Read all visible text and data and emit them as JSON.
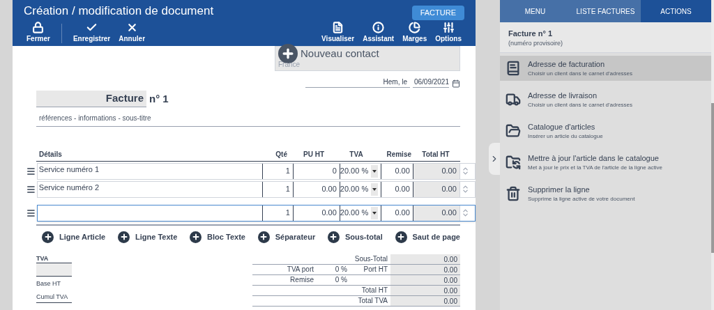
{
  "header": {
    "title": "Création / modification de document",
    "doc_type": "FACTURE",
    "left_tools": [
      {
        "kind": "lock",
        "label": "Fermer"
      },
      {
        "kind": "check",
        "label": "Enregistrer"
      },
      {
        "kind": "cancel",
        "label": "Annuler"
      }
    ],
    "right_tools": [
      {
        "kind": "pdf",
        "label": "Visualiser"
      },
      {
        "kind": "info",
        "label": "Assistant"
      },
      {
        "kind": "pie",
        "label": "Marges"
      },
      {
        "kind": "options",
        "label": "Options"
      }
    ]
  },
  "contact": {
    "button": "Nouveau contact",
    "country": "France"
  },
  "place": "Hem, le",
  "date": "06/09/2021",
  "doc_title": {
    "type": "Facture",
    "number": "n° 1"
  },
  "subtitle": "références - informations - sous-titre",
  "columns": [
    "Détails",
    "Qté",
    "PU HT",
    "TVA",
    "Remise",
    "Total HT"
  ],
  "lines": [
    {
      "details": "Service numéro 1",
      "qty": "1",
      "pu_ht": "0",
      "tva": "20.00 %",
      "remise": "0.00",
      "total_ht": "0.00",
      "active": false
    },
    {
      "details": "Service numéro 2",
      "qty": "1",
      "pu_ht": "0.00",
      "tva": "20.00 %",
      "remise": "0.00",
      "total_ht": "0.00",
      "active": false
    },
    {
      "qty": "1",
      "pu_ht": "0.00",
      "tva": "20.00 %",
      "remise": "0.00",
      "total_ht": "0.00",
      "active": true
    }
  ],
  "add_buttons": [
    "Ligne Article",
    "Ligne Texte",
    "Bloc Texte",
    "Séparateur",
    "Sous-total",
    "Saut de page"
  ],
  "vat_table": {
    "heading": "TVA",
    "rows": [
      "Base HT",
      "Cumul TVA"
    ]
  },
  "totals": [
    {
      "label": "Sous-Total",
      "value": "0.00"
    },
    {
      "extra_label": "TVA port",
      "extra_value": "0 %",
      "label": "Port HT",
      "value": "0.00"
    },
    {
      "extra_label": "Remise",
      "extra_value": "0 %",
      "value": "0.00"
    },
    {
      "label": "Total HT",
      "value": "0.00"
    },
    {
      "label": "Total TVA",
      "value": "0.00"
    }
  ],
  "sidebar": {
    "tabs": [
      {
        "label": "MENU",
        "selected": false
      },
      {
        "label": "LISTE FACTURES",
        "selected": false
      },
      {
        "label": "ACTIONS",
        "selected": true
      }
    ],
    "doc_title": "Facture n° 1",
    "doc_note": "(numéro provisoire)",
    "actions": [
      {
        "kind": "book",
        "title": "Adresse de facturation",
        "description": "Choisir un client dans le carnet d'adresses",
        "selected": true
      },
      {
        "kind": "truck",
        "title": "Adresse de livraison",
        "description": "Choisir un client dans le carnet d'adresses",
        "selected": false
      },
      {
        "kind": "folder",
        "title": "Catalogue d'articles",
        "description": "Insérer un article du catalogue",
        "selected": false
      },
      {
        "kind": "folder-sync",
        "title": "Mettre à jour l'article dans le catalogue",
        "description": "Met à jour le prix et la TVA de l'article de la ligne active",
        "selected": false
      },
      {
        "kind": "trash",
        "title": "Supprimer la ligne",
        "description": "Supprime la ligne active de votre document",
        "selected": false
      }
    ]
  }
}
